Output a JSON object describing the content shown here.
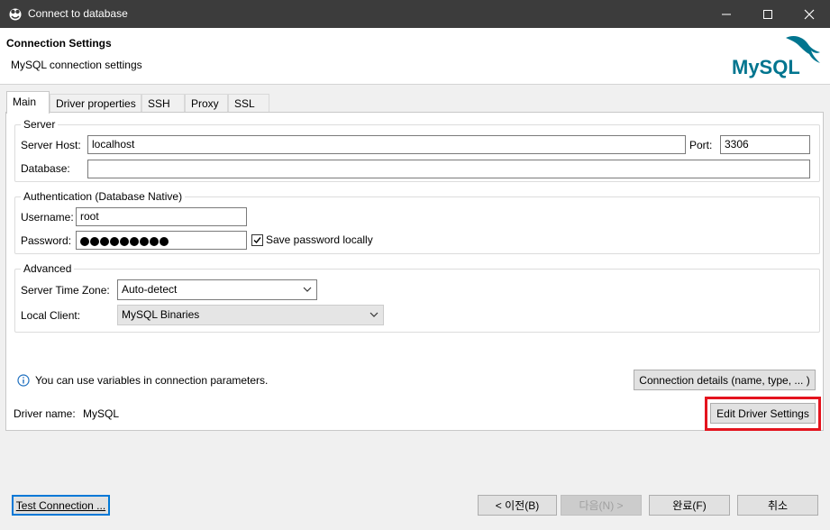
{
  "window": {
    "title": "Connect to database",
    "app_icon": "dbeaver-beaver-icon",
    "controls": [
      "minimize-icon",
      "maximize-icon",
      "close-icon"
    ]
  },
  "header": {
    "title": "Connection Settings",
    "subtitle": "MySQL connection settings",
    "logo_text": "MySQL"
  },
  "tabs": [
    {
      "label": "Main",
      "active": true
    },
    {
      "label": "Driver properties",
      "active": false
    },
    {
      "label": "SSH",
      "active": false
    },
    {
      "label": "Proxy",
      "active": false
    },
    {
      "label": "SSL",
      "active": false
    }
  ],
  "server": {
    "group_label": "Server",
    "host_label": "Server Host:",
    "host_value": "localhost",
    "port_label": "Port:",
    "port_value": "3306",
    "database_label": "Database:",
    "database_value": ""
  },
  "auth": {
    "group_label": "Authentication (Database Native)",
    "username_label": "Username:",
    "username_value": "root",
    "password_label": "Password:",
    "password_mask_count": 9,
    "save_password_label": "Save password locally",
    "save_password_checked": true
  },
  "advanced": {
    "group_label": "Advanced",
    "timezone_label": "Server Time Zone:",
    "timezone_value": "Auto-detect",
    "client_label": "Local Client:",
    "client_value": "MySQL Binaries"
  },
  "info": {
    "text": "You can use variables in connection parameters.",
    "connection_details_button": "Connection details (name, type, ... )"
  },
  "driver": {
    "label": "Driver name:",
    "value": "MySQL",
    "edit_button": "Edit Driver Settings"
  },
  "footer": {
    "test_button": "Test Connection ...",
    "back_button": "< 이전(B)",
    "next_button": "다음(N) >",
    "finish_button": "완료(F)",
    "cancel_button": "취소"
  },
  "colors": {
    "titlebar": "#3c3c3c",
    "highlight": "#e4141e",
    "mysql_blue": "#00758f",
    "mysql_orange": "#f29111"
  }
}
